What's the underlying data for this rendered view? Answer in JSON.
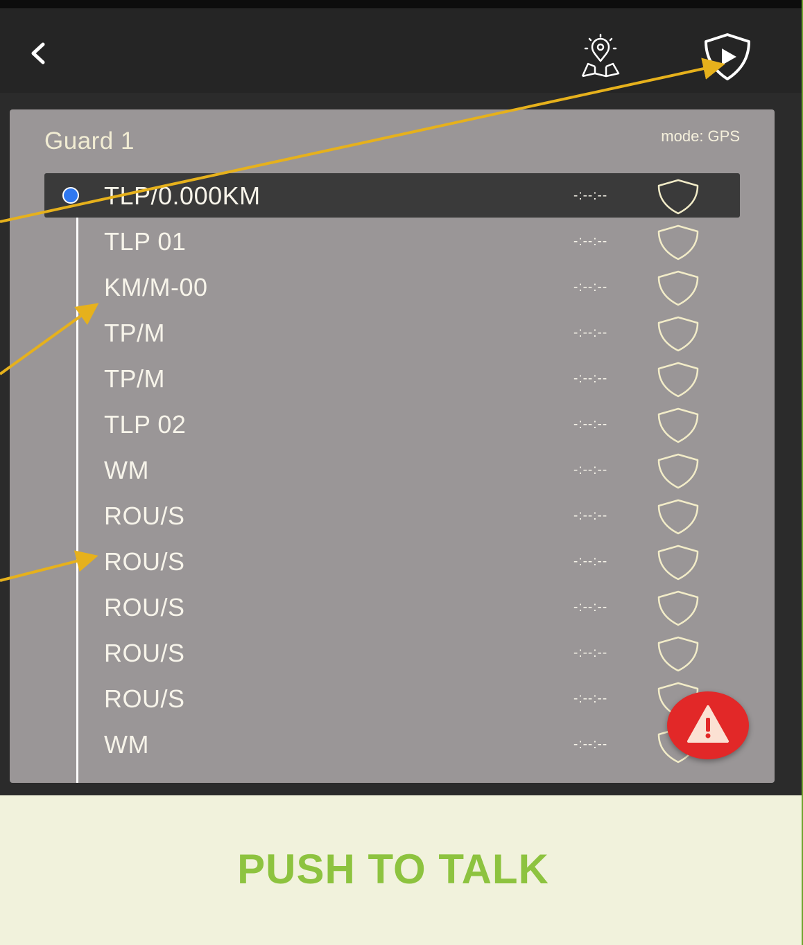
{
  "header": {
    "back_icon": "chevron-left-icon",
    "map_icon": "map-pin-icon",
    "start_patrol_icon": "play-shield-icon"
  },
  "route": {
    "title": "Guard 1",
    "mode": "mode: GPS",
    "checkpoints": [
      {
        "name": "TLP/0.000KM",
        "time": "-:--:--",
        "active": true
      },
      {
        "name": "TLP 01",
        "time": "-:--:--"
      },
      {
        "name": "KM/M-00",
        "time": "-:--:--"
      },
      {
        "name": "TP/M",
        "time": "-:--:--"
      },
      {
        "name": "TP/M",
        "time": "-:--:--"
      },
      {
        "name": "TLP 02",
        "time": "-:--:--"
      },
      {
        "name": "WM",
        "time": "-:--:--"
      },
      {
        "name": "ROU/S",
        "time": "-:--:--"
      },
      {
        "name": "ROU/S",
        "time": "-:--:--"
      },
      {
        "name": "ROU/S",
        "time": "-:--:--"
      },
      {
        "name": "ROU/S",
        "time": "-:--:--"
      },
      {
        "name": "ROU/S",
        "time": "-:--:--"
      },
      {
        "name": "WM",
        "time": "-:--:--"
      }
    ]
  },
  "alert": {
    "icon": "warning-icon"
  },
  "ptt": {
    "label": "PUSH TO TALK"
  },
  "colors": {
    "accent_green": "#8dc33f",
    "alert_red": "#e22828",
    "active_dot": "#2f78f0",
    "annotation_arrow": "#e6b11c"
  }
}
